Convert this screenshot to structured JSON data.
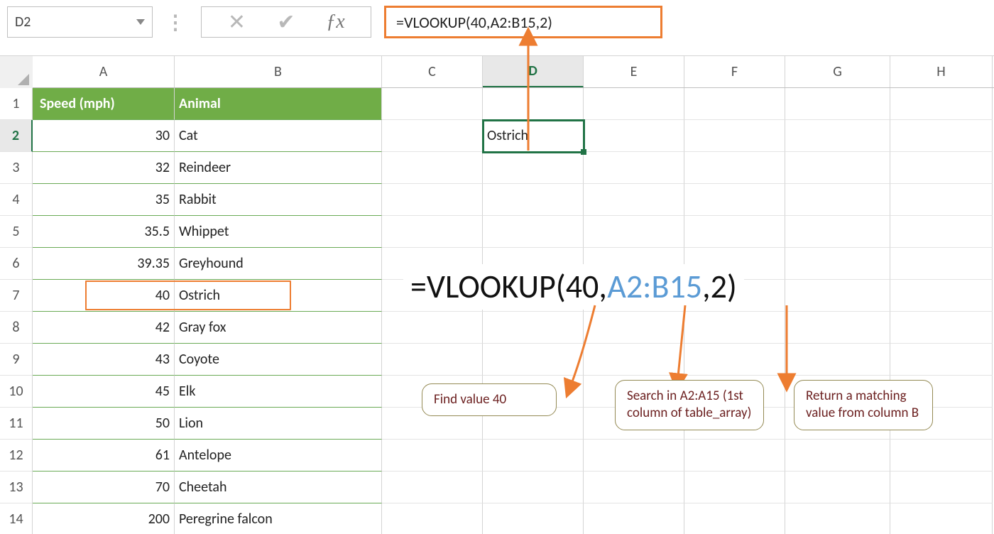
{
  "name_box": "D2",
  "formula": "=VLOOKUP(40,A2:B15,2)",
  "columns": [
    "A",
    "B",
    "C",
    "D",
    "E",
    "F",
    "G",
    "H"
  ],
  "active_column": "D",
  "active_row": 2,
  "result_cell_value": "Ostrich",
  "table": {
    "headers": [
      "Speed (mph)",
      "Animal"
    ],
    "rows": [
      {
        "n": 1
      },
      {
        "n": 2,
        "speed": "30",
        "animal": "Cat"
      },
      {
        "n": 3,
        "speed": "32",
        "animal": "Reindeer"
      },
      {
        "n": 4,
        "speed": "35",
        "animal": "Rabbit"
      },
      {
        "n": 5,
        "speed": "35.5",
        "animal": "Whippet"
      },
      {
        "n": 6,
        "speed": "39.35",
        "animal": "Greyhound"
      },
      {
        "n": 7,
        "speed": "40",
        "animal": "Ostrich"
      },
      {
        "n": 8,
        "speed": "42",
        "animal": "Gray fox"
      },
      {
        "n": 9,
        "speed": "43",
        "animal": "Coyote"
      },
      {
        "n": 10,
        "speed": "45",
        "animal": "Elk"
      },
      {
        "n": 11,
        "speed": "50",
        "animal": "Lion"
      },
      {
        "n": 12,
        "speed": "61",
        "animal": "Antelope"
      },
      {
        "n": 13,
        "speed": "70",
        "animal": "Cheetah"
      },
      {
        "n": 14,
        "speed": "200",
        "animal": "Peregrine falcon"
      }
    ]
  },
  "big_formula": {
    "prefix": "=VLOOKUP(40,",
    "ref": "A2:B15",
    "suffix": ",2)"
  },
  "callouts": {
    "c1": "Find value 40",
    "c2": "Search in A2:A15 (1st column of table_array)",
    "c3": "Return a matching value from column B"
  }
}
